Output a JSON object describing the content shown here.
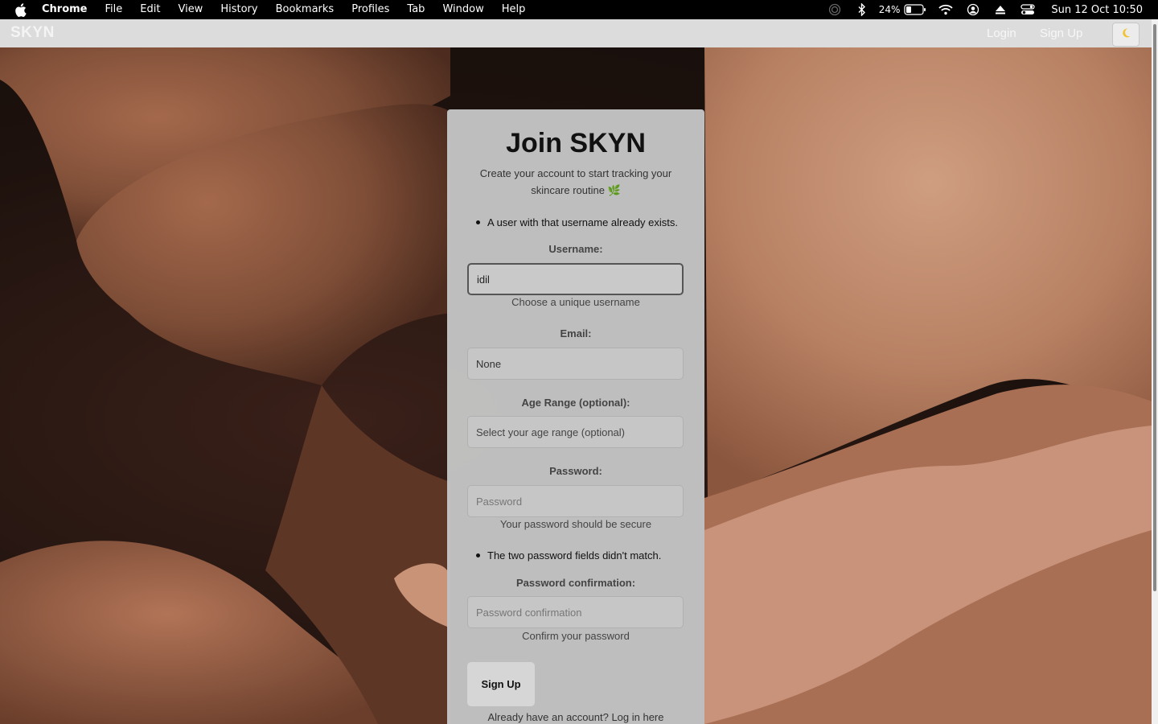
{
  "menubar": {
    "app_name": "Chrome",
    "items": [
      "File",
      "Edit",
      "View",
      "History",
      "Bookmarks",
      "Profiles",
      "Tab",
      "Window",
      "Help"
    ],
    "battery": "24%",
    "clock": "Sun 12 Oct  10:50"
  },
  "navbar": {
    "brand": "SKYN",
    "login": "Login",
    "signup": "Sign Up",
    "theme_icon": "moon-icon"
  },
  "form": {
    "title": "Join SKYN",
    "subtitle": "Create your account to start tracking your skincare routine 🌿",
    "username_error": "A user with that username already exists.",
    "username_label": "Username:",
    "username_value": "idil",
    "username_help": "Choose a unique username",
    "email_label": "Email:",
    "email_value": "None",
    "age_label": "Age Range (optional):",
    "age_value": "Select your age range (optional)",
    "password_label": "Password:",
    "password_placeholder": "Password",
    "password_help": "Your password should be secure",
    "password_error": "The two password fields didn't match.",
    "confirm_label": "Password confirmation:",
    "confirm_placeholder": "Password confirmation",
    "confirm_help": "Confirm your password",
    "submit": "Sign Up",
    "footer_prefix": "Already have an account? ",
    "footer_link": "Log in here"
  }
}
